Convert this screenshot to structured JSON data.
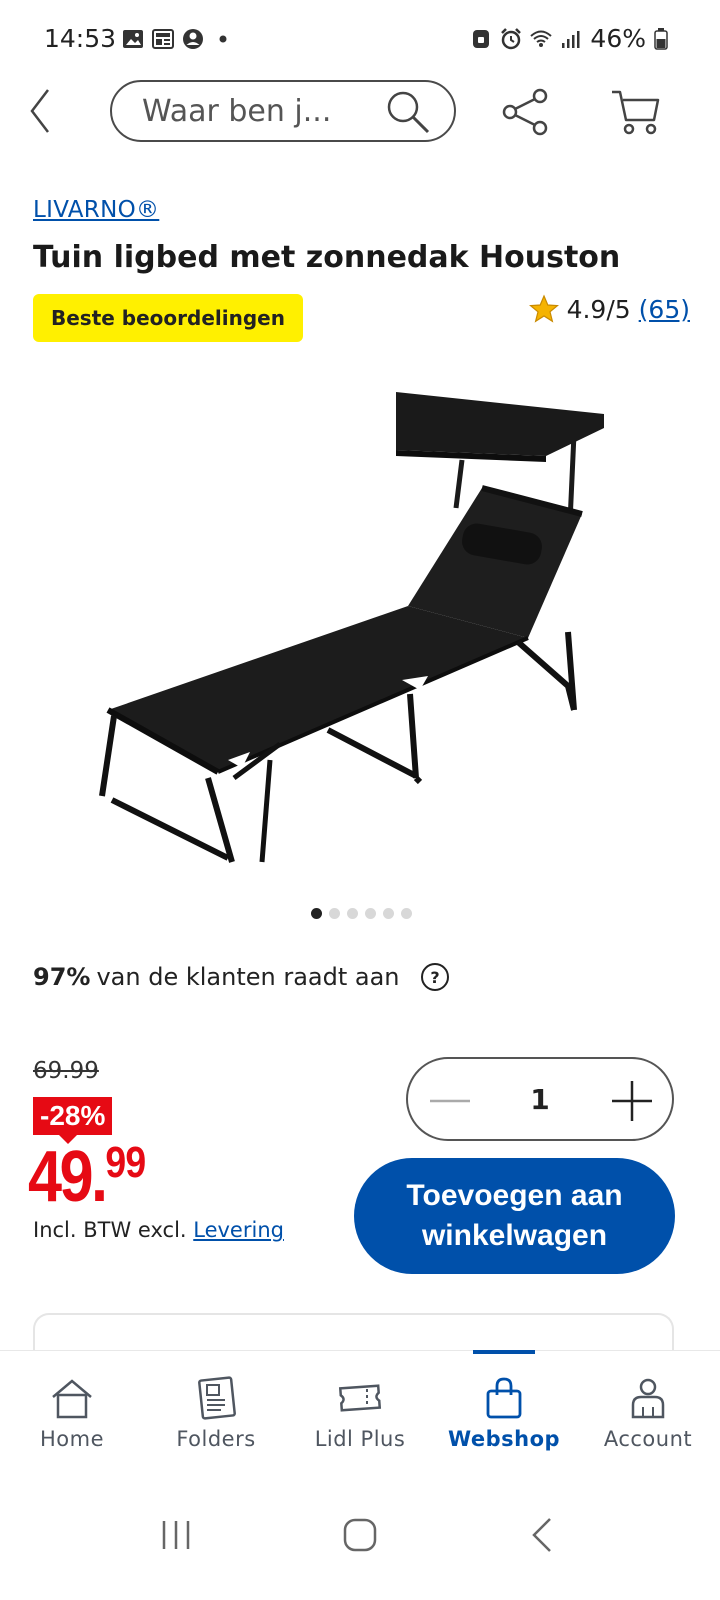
{
  "status_bar": {
    "time": "14:53",
    "battery_pct": "46%",
    "left_icons": [
      "image-icon",
      "news-icon",
      "account-circle-icon",
      "dot-icon"
    ],
    "right_icons": [
      "lock-icon",
      "alarm-icon",
      "wifi-icon",
      "signal-icon",
      "battery-icon"
    ]
  },
  "search": {
    "placeholder": "Waar ben j..."
  },
  "product": {
    "brand": "LIVARNO®",
    "title": "Tuin ligbed met zonnedak Houston",
    "badge": "Beste beoordelingen",
    "rating": "4.9/5",
    "rating_count": "(65)",
    "image_count": 6,
    "active_image_index": 0
  },
  "recommend": {
    "percent": "97%",
    "text": "van de klanten raadt aan"
  },
  "price": {
    "old": "69.99",
    "discount": "-28%",
    "euros": "49.",
    "cents": "99",
    "vat_text": "Incl. BTW excl. ",
    "delivery_link": "Levering"
  },
  "quantity": {
    "value": "1"
  },
  "add_to_cart": {
    "line1": "Toevoegen aan",
    "line2": "winkelwagen"
  },
  "bottom_nav": [
    {
      "label": "Home",
      "icon": "home-icon"
    },
    {
      "label": "Folders",
      "icon": "folder-icon"
    },
    {
      "label": "Lidl Plus",
      "icon": "ticket-icon"
    },
    {
      "label": "Webshop",
      "icon": "shopping-bag-icon",
      "active": true
    },
    {
      "label": "Account",
      "icon": "person-icon"
    }
  ],
  "colors": {
    "brand_blue": "#0050aa",
    "sale_red": "#e60a14",
    "badge_yellow": "#fff000"
  }
}
